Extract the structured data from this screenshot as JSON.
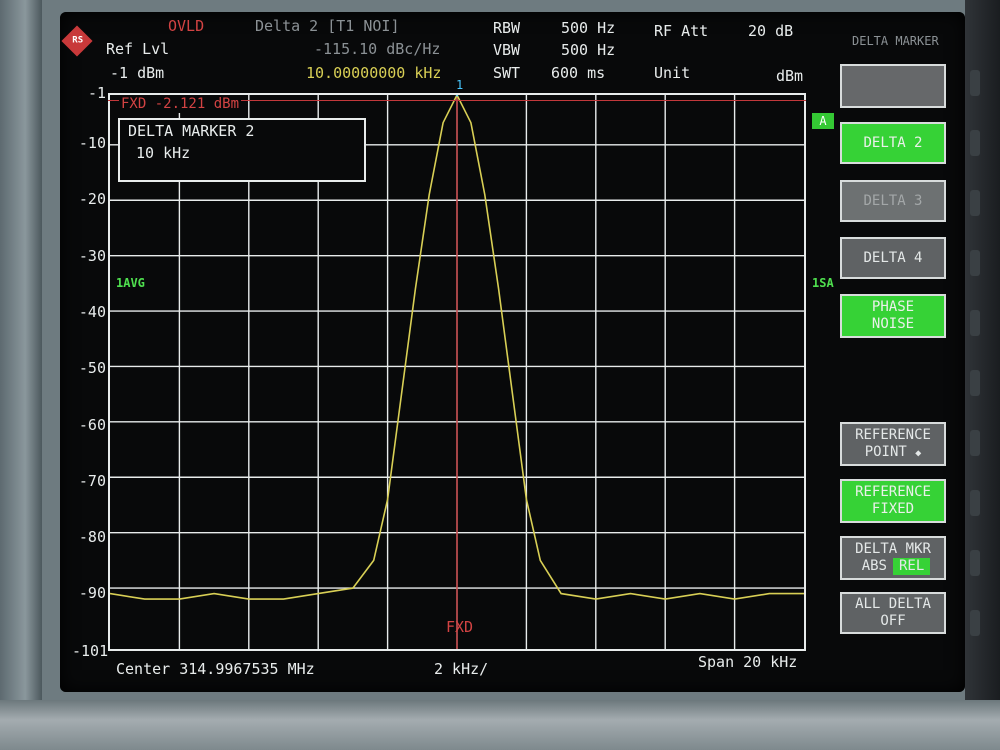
{
  "header": {
    "ovld": "OVLD",
    "ref_lvl_label": "Ref Lvl",
    "ref_lvl_value": "-1 dBm",
    "delta_title": "Delta 2 [T1 NOI]",
    "delta_value": "-115.10 dBc/Hz",
    "delta_freq": "10.00000000 kHz",
    "rbw_label": "RBW",
    "rbw_value": "500 Hz",
    "vbw_label": "VBW",
    "vbw_value": "500 Hz",
    "swt_label": "SWT",
    "swt_value": "600 ms",
    "rf_att_label": "RF Att",
    "rf_att_value": "20 dB",
    "unit_label": "Unit",
    "unit_value": "dBm",
    "corner_label": "DELTA MARKER"
  },
  "plot": {
    "fxd_label": "FXD -2.121 dBm",
    "marker_box_title": "DELTA MARKER 2",
    "marker_box_value": "10 kHz",
    "avg_left": "1AVG",
    "avg_right": "1SA",
    "trace_a": "A",
    "fxd_bottom": "FXD",
    "marker_num": "1",
    "center_label": "Center 314.9967535 MHz",
    "div_label": "2 kHz/",
    "span_label": "Span 20 kHz"
  },
  "y_ticks": [
    "-1",
    "-10",
    "-20",
    "-30",
    "-40",
    "-50",
    "-60",
    "-70",
    "-80",
    "-90",
    "-101"
  ],
  "softkeys": {
    "delta2": "DELTA 2",
    "delta3": "DELTA 3",
    "delta4": "DELTA 4",
    "phase_noise_1": "PHASE",
    "phase_noise_2": "NOISE",
    "ref_point_1": "REFERENCE",
    "ref_point_2": "POINT",
    "ref_fixed_1": "REFERENCE",
    "ref_fixed_2": "FIXED",
    "delta_mkr_1": "DELTA MKR",
    "delta_mkr_abs": "ABS",
    "delta_mkr_rel": "REL",
    "all_delta_1": "ALL DELTA",
    "all_delta_2": "OFF"
  },
  "colors": {
    "trace": "#d8cf55",
    "grid": "#e8ecec",
    "ref_line": "#c2383b",
    "softkey_active": "#36d236"
  },
  "chart_data": {
    "type": "line",
    "x_unit": "kHz offset from center",
    "xlim": [
      -10,
      10
    ],
    "ylim": [
      -101,
      -1
    ],
    "grid": true,
    "series": [
      {
        "x": [
          -10,
          -9,
          -8,
          -7,
          -6,
          -5,
          -4,
          -3,
          -2.4,
          -2,
          -1.6,
          -1.2,
          -0.8,
          -0.4,
          0,
          0.4,
          0.8,
          1.2,
          1.6,
          2,
          2.4,
          3,
          4,
          5,
          6,
          7,
          8,
          9,
          10
        ],
        "values": [
          -91,
          -92,
          -92,
          -91,
          -92,
          -92,
          -91,
          -90,
          -85,
          -74,
          -55,
          -36,
          -19,
          -6,
          -1,
          -6,
          -19,
          -36,
          -55,
          -74,
          -85,
          -91,
          -92,
          -91,
          -92,
          -91,
          -92,
          -91,
          -91
        ]
      }
    ]
  }
}
